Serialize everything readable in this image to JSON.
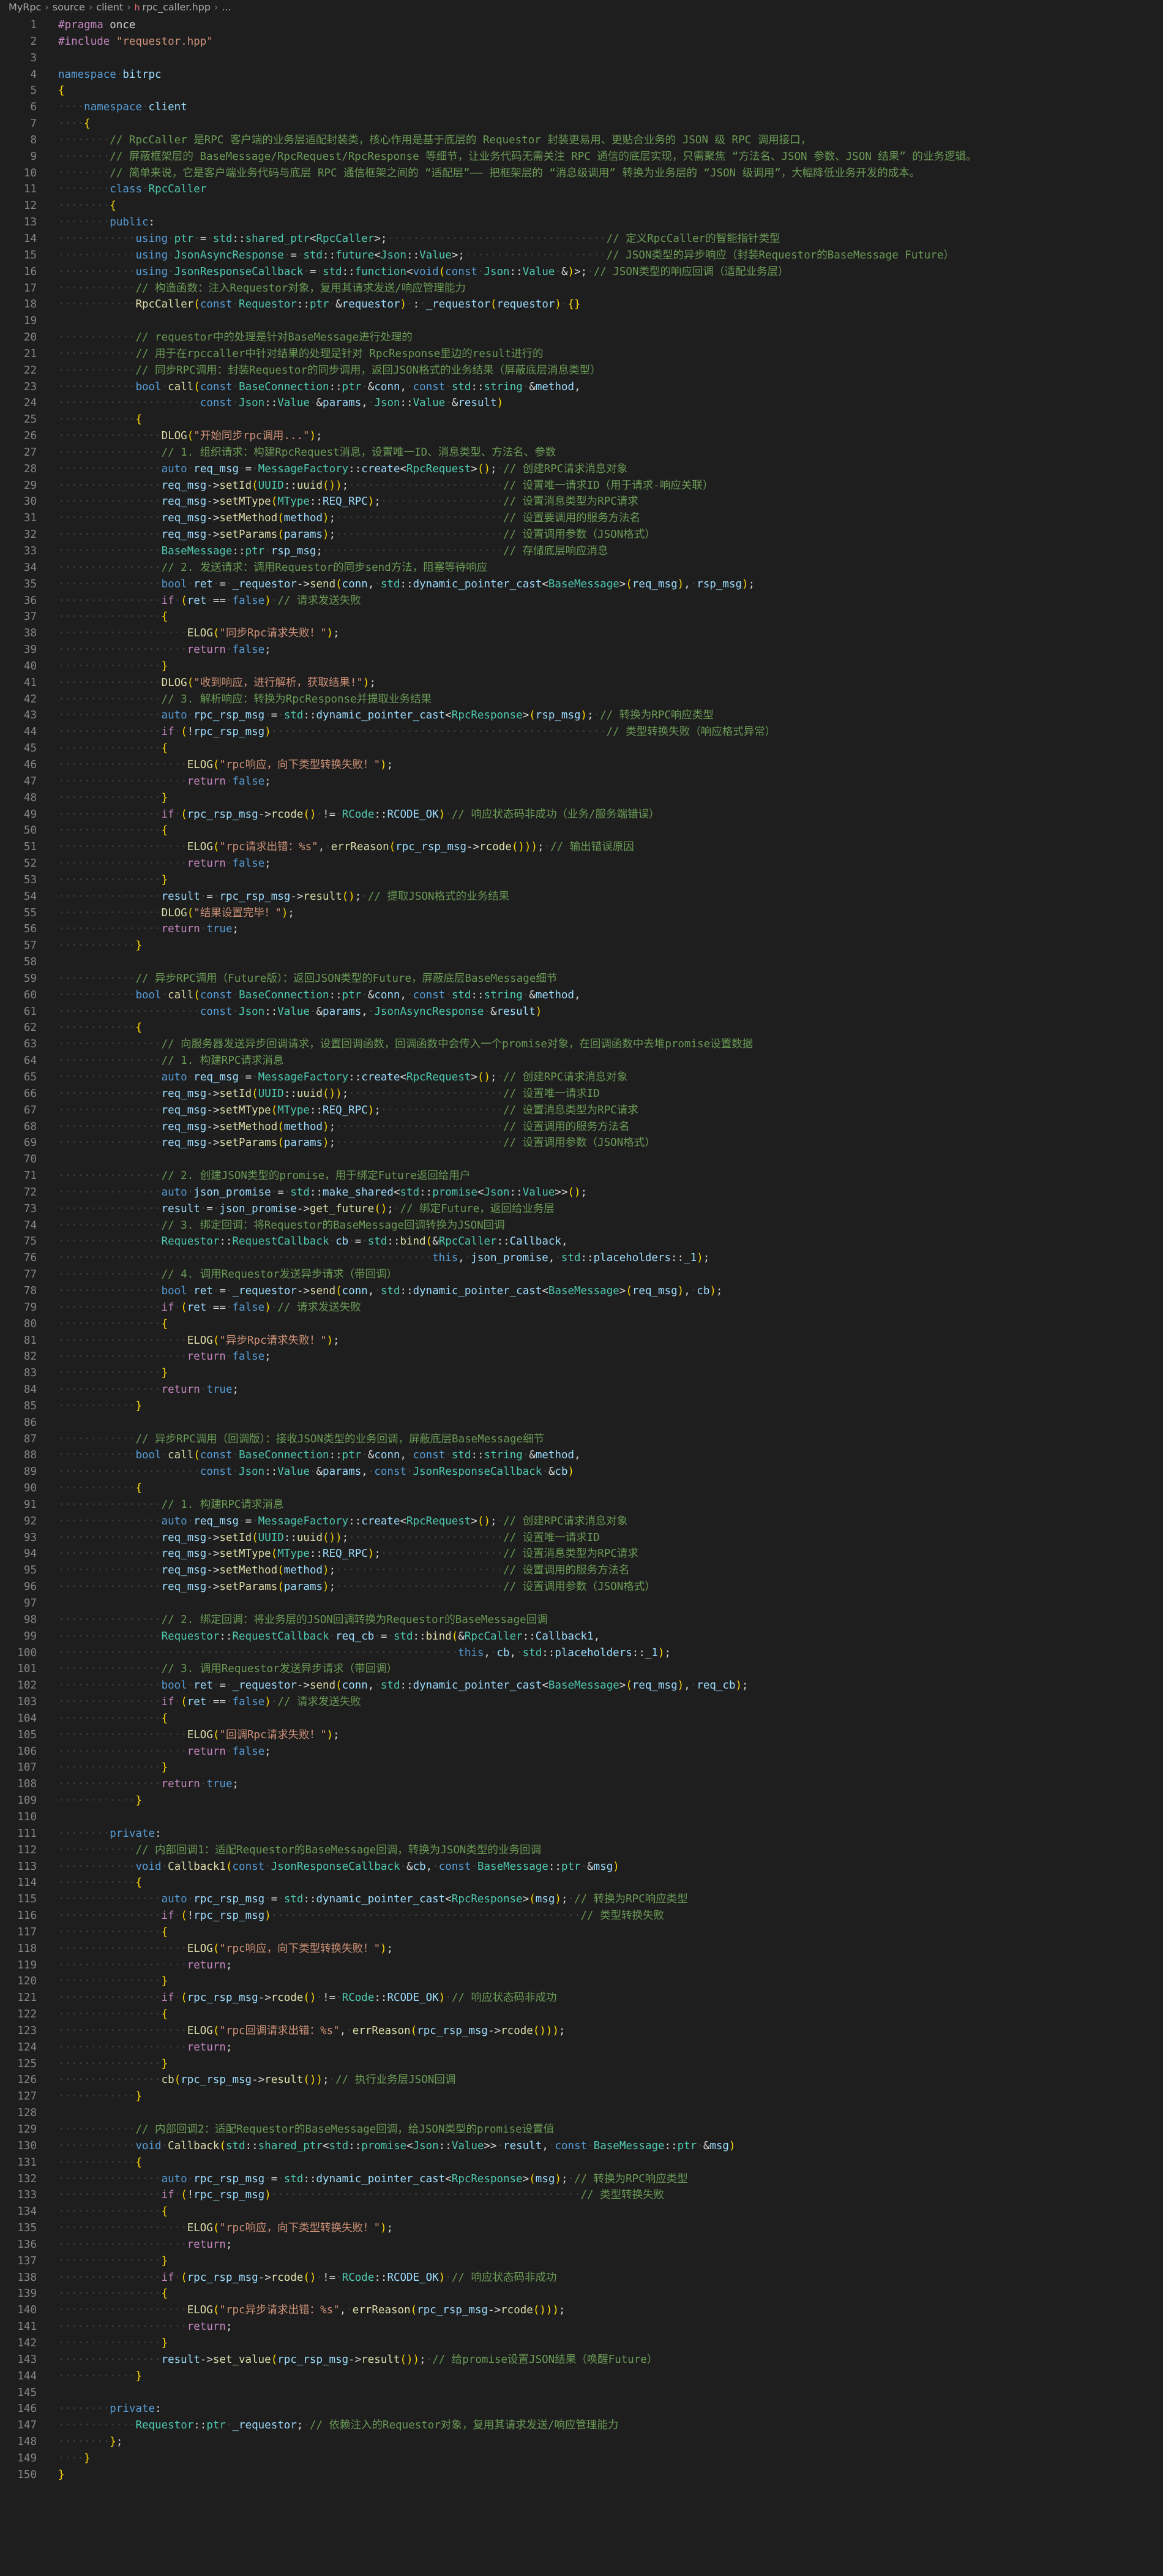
{
  "breadcrumb": [
    "MyRpc",
    "source",
    "client",
    "rpc_caller.hpp",
    "..."
  ],
  "editor": {
    "file": "rpc_caller.hpp",
    "lines": [
      "#pragma once",
      "#include \"requestor.hpp\"",
      "",
      "namespace bitrpc",
      "{",
      "    namespace client",
      "    {",
      "        // RpcCaller 是RPC 客户端的业务层适配封装类，核心作用是基于底层的 Requestor 封装更易用、更贴合业务的 JSON 级 RPC 调用接口，",
      "        // 屏蔽框架层的 BaseMessage/RpcRequest/RpcResponse 等细节，让业务代码无需关注 RPC 通信的底层实现，只需聚焦 “方法名、JSON 参数、JSON 结果” 的业务逻辑。",
      "        // 简单来说，它是客户端业务代码与底层 RPC 通信框架之间的 “适配层”—— 把框架层的 “消息级调用” 转换为业务层的 “JSON 级调用”，大幅降低业务开发的成本。",
      "        class RpcCaller",
      "        {",
      "        public:",
      "            using ptr = std::shared_ptr<RpcCaller>;                                  // 定义RpcCaller的智能指针类型",
      "            using JsonAsyncResponse = std::future<Json::Value>;                      // JSON类型的异步响应（封装Requestor的BaseMessage Future）",
      "            using JsonResponseCallback = std::function<void(const Json::Value &)>; // JSON类型的响应回调（适配业务层）",
      "            // 构造函数：注入Requestor对象，复用其请求发送/响应管理能力",
      "            RpcCaller(const Requestor::ptr &requestor) : _requestor(requestor) {}",
      "",
      "            // requestor中的处理是针对BaseMessage进行处理的",
      "            // 用于在rpccaller中针对结果的处理是针对 RpcResponse里边的result进行的",
      "            // 同步RPC调用：封装Requestor的同步调用，返回JSON格式的业务结果（屏蔽底层消息类型）",
      "            bool call(const BaseConnection::ptr &conn, const std::string &method,",
      "                      const Json::Value &params, Json::Value &result)",
      "            {",
      "                DLOG(\"开始同步rpc调用...\");",
      "                // 1. 组织请求：构建RpcRequest消息，设置唯一ID、消息类型、方法名、参数",
      "                auto req_msg = MessageFactory::create<RpcRequest>(); // 创建RPC请求消息对象",
      "                req_msg->setId(UUID::uuid());                        // 设置唯一请求ID（用于请求-响应关联）",
      "                req_msg->setMType(MType::REQ_RPC);                   // 设置消息类型为RPC请求",
      "                req_msg->setMethod(method);                          // 设置要调用的服务方法名",
      "                req_msg->setParams(params);                          // 设置调用参数（JSON格式）",
      "                BaseMessage::ptr rsp_msg;                            // 存储底层响应消息",
      "                // 2. 发送请求：调用Requestor的同步send方法，阻塞等待响应",
      "                bool ret = _requestor->send(conn, std::dynamic_pointer_cast<BaseMessage>(req_msg), rsp_msg);",
      "                if (ret == false) // 请求发送失败",
      "                {",
      "                    ELOG(\"同步Rpc请求失败！\");",
      "                    return false;",
      "                }",
      "                DLOG(\"收到响应，进行解析，获取结果!\");",
      "                // 3. 解析响应：转换为RpcResponse并提取业务结果",
      "                auto rpc_rsp_msg = std::dynamic_pointer_cast<RpcResponse>(rsp_msg); // 转换为RPC响应类型",
      "                if (!rpc_rsp_msg)                                                    // 类型转换失败（响应格式异常）",
      "                {",
      "                    ELOG(\"rpc响应，向下类型转换失败！\");",
      "                    return false;",
      "                }",
      "                if (rpc_rsp_msg->rcode() != RCode::RCODE_OK) // 响应状态码非成功（业务/服务端错误）",
      "                {",
      "                    ELOG(\"rpc请求出错：%s\", errReason(rpc_rsp_msg->rcode())); // 输出错误原因",
      "                    return false;",
      "                }",
      "                result = rpc_rsp_msg->result(); // 提取JSON格式的业务结果",
      "                DLOG(\"结果设置完毕！\");",
      "                return true;",
      "            }",
      "",
      "            // 异步RPC调用（Future版）：返回JSON类型的Future，屏蔽底层BaseMessage细节",
      "            bool call(const BaseConnection::ptr &conn, const std::string &method,",
      "                      const Json::Value &params, JsonAsyncResponse &result)",
      "            {",
      "                // 向服务器发送异步回调请求，设置回调函数，回调函数中会传入一个promise对象，在回调函数中去堆promise设置数据",
      "                // 1. 构建RPC请求消息",
      "                auto req_msg = MessageFactory::create<RpcRequest>(); // 创建RPC请求消息对象",
      "                req_msg->setId(UUID::uuid());                        // 设置唯一请求ID",
      "                req_msg->setMType(MType::REQ_RPC);                   // 设置消息类型为RPC请求",
      "                req_msg->setMethod(method);                          // 设置调用的服务方法名",
      "                req_msg->setParams(params);                          // 设置调用参数（JSON格式）",
      "",
      "                // 2. 创建JSON类型的promise，用于绑定Future返回给用户",
      "                auto json_promise = std::make_shared<std::promise<Json::Value>>();",
      "                result = json_promise->get_future(); // 绑定Future，返回给业务层",
      "                // 3. 绑定回调：将Requestor的BaseMessage回调转换为JSON回调",
      "                Requestor::RequestCallback cb = std::bind(&RpcCaller::Callback,",
      "                                                          this, json_promise, std::placeholders::_1);",
      "                // 4. 调用Requestor发送异步请求（带回调）",
      "                bool ret = _requestor->send(conn, std::dynamic_pointer_cast<BaseMessage>(req_msg), cb);",
      "                if (ret == false) // 请求发送失败",
      "                {",
      "                    ELOG(\"异步Rpc请求失败！\");",
      "                    return false;",
      "                }",
      "                return true;",
      "            }",
      "",
      "            // 异步RPC调用（回调版）：接收JSON类型的业务回调，屏蔽底层BaseMessage细节",
      "            bool call(const BaseConnection::ptr &conn, const std::string &method,",
      "                      const Json::Value &params, const JsonResponseCallback &cb)",
      "            {",
      "                // 1. 构建RPC请求消息",
      "                auto req_msg = MessageFactory::create<RpcRequest>(); // 创建RPC请求消息对象",
      "                req_msg->setId(UUID::uuid());                        // 设置唯一请求ID",
      "                req_msg->setMType(MType::REQ_RPC);                   // 设置消息类型为RPC请求",
      "                req_msg->setMethod(method);                          // 设置调用的服务方法名",
      "                req_msg->setParams(params);                          // 设置调用参数（JSON格式）",
      "",
      "                // 2. 绑定回调：将业务层的JSON回调转换为Requestor的BaseMessage回调",
      "                Requestor::RequestCallback req_cb = std::bind(&RpcCaller::Callback1,",
      "                                                              this, cb, std::placeholders::_1);",
      "                // 3. 调用Requestor发送异步请求（带回调）",
      "                bool ret = _requestor->send(conn, std::dynamic_pointer_cast<BaseMessage>(req_msg), req_cb);",
      "                if (ret == false) // 请求发送失败",
      "                {",
      "                    ELOG(\"回调Rpc请求失败！\");",
      "                    return false;",
      "                }",
      "                return true;",
      "            }",
      "",
      "        private:",
      "            // 内部回调1：适配Requestor的BaseMessage回调，转换为JSON类型的业务回调",
      "            void Callback1(const JsonResponseCallback &cb, const BaseMessage::ptr &msg)",
      "            {",
      "                auto rpc_rsp_msg = std::dynamic_pointer_cast<RpcResponse>(msg); // 转换为RPC响应类型",
      "                if (!rpc_rsp_msg)                                                // 类型转换失败",
      "                {",
      "                    ELOG(\"rpc响应，向下类型转换失败！\");",
      "                    return;",
      "                }",
      "                if (rpc_rsp_msg->rcode() != RCode::RCODE_OK) // 响应状态码非成功",
      "                {",
      "                    ELOG(\"rpc回调请求出错：%s\", errReason(rpc_rsp_msg->rcode()));",
      "                    return;",
      "                }",
      "                cb(rpc_rsp_msg->result()); // 执行业务层JSON回调",
      "            }",
      "",
      "            // 内部回调2：适配Requestor的BaseMessage回调，给JSON类型的promise设置值",
      "            void Callback(std::shared_ptr<std::promise<Json::Value>> result, const BaseMessage::ptr &msg)",
      "            {",
      "                auto rpc_rsp_msg = std::dynamic_pointer_cast<RpcResponse>(msg); // 转换为RPC响应类型",
      "                if (!rpc_rsp_msg)                                                // 类型转换失败",
      "                {",
      "                    ELOG(\"rpc响应，向下类型转换失败！\");",
      "                    return;",
      "                }",
      "                if (rpc_rsp_msg->rcode() != RCode::RCODE_OK) // 响应状态码非成功",
      "                {",
      "                    ELOG(\"rpc异步请求出错：%s\", errReason(rpc_rsp_msg->rcode()));",
      "                    return;",
      "                }",
      "                result->set_value(rpc_rsp_msg->result()); // 给promise设置JSON结果（唤醒Future）",
      "            }",
      "",
      "        private:",
      "            Requestor::ptr _requestor; // 依赖注入的Requestor对象，复用其请求发送/响应管理能力",
      "        };",
      "    }",
      "}"
    ]
  }
}
